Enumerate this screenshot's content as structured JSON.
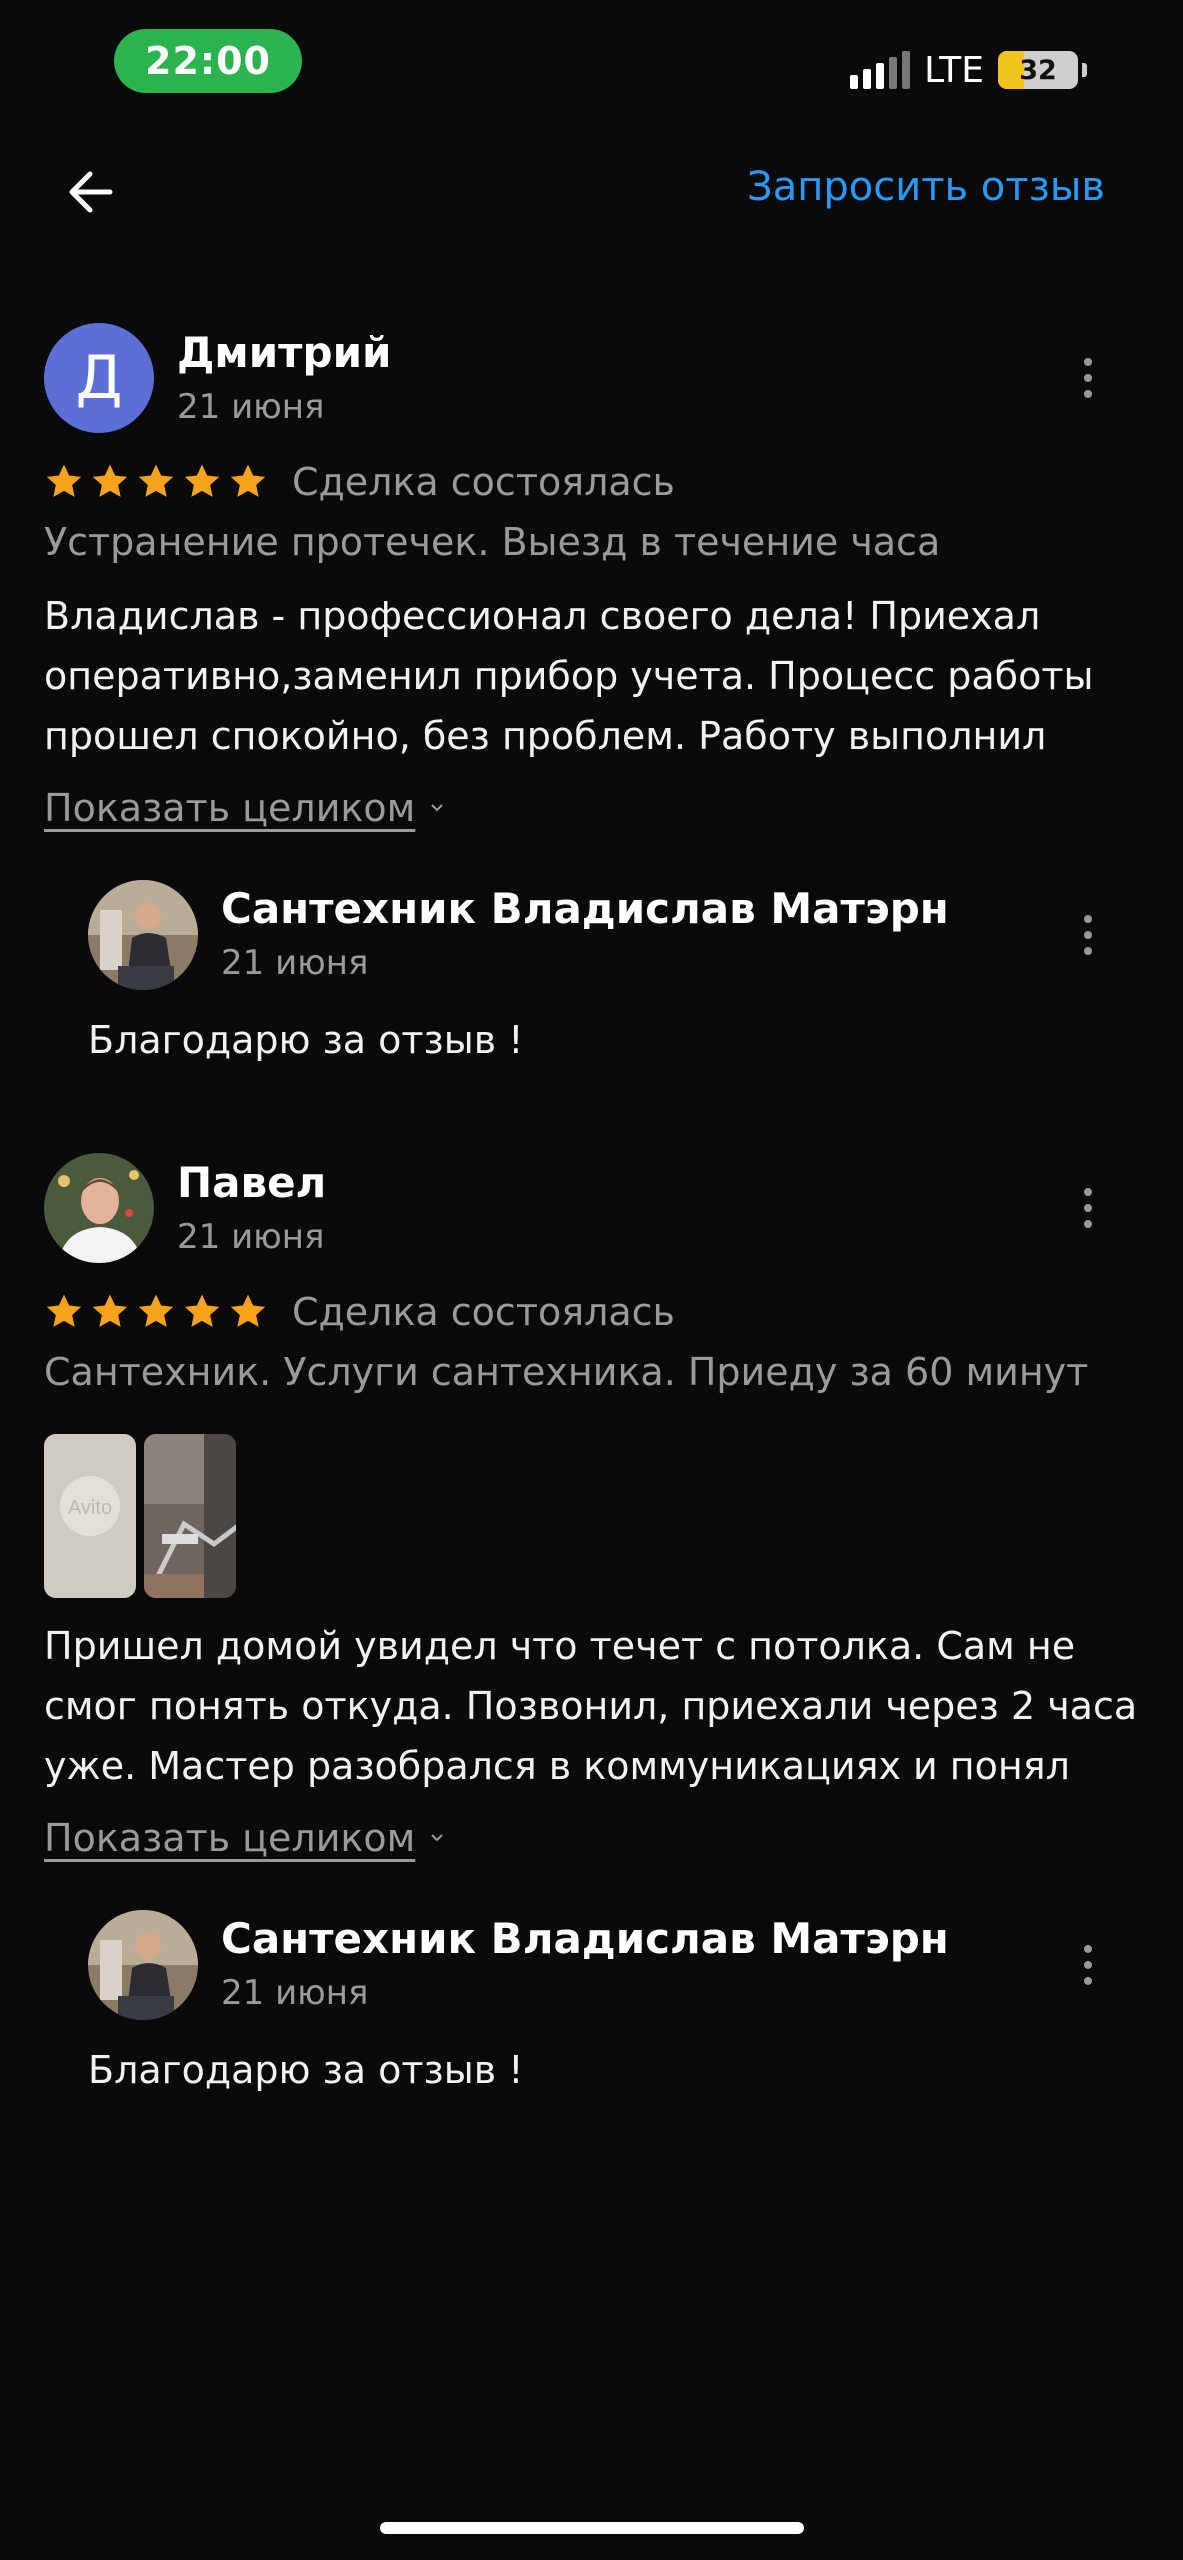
{
  "status_bar": {
    "time": "22:00",
    "network": "LTE",
    "battery": "32"
  },
  "header": {
    "back_icon": "arrow-left-icon",
    "request_review": "Запросить отзыв"
  },
  "reviews": [
    {
      "avatar_letter": "Д",
      "name": "Дмитрий",
      "date": "21 июня",
      "rating": 5,
      "deal_status": "Сделка состоялась",
      "service": "Устранение протечек. Выезд в течение часа",
      "text": "Владислав - профессионал своего дела! Приехал оперативно,заменил прибор учета. Процесс работы прошел спокойно, без проблем. Работу выполнил",
      "show_more": "Показать целиком",
      "reply": {
        "name": "Сантехник Владислав Матэрн",
        "date": "21 июня",
        "text": "Благодарю за отзыв !"
      }
    },
    {
      "name": "Павел",
      "date": "21 июня",
      "rating": 5,
      "deal_status": "Сделка состоялась",
      "service": "Сантехник. Услуги сантехника. Приеду за 60 минут",
      "photo_watermark": "Avito",
      "text": "Пришел домой увидел что течет с потолка. Сам не смог понять откуда. Позвонил, приехали через 2 часа уже. Мастер разобрался в коммуникациях и понял",
      "show_more": "Показать целиком",
      "reply": {
        "name": "Сантехник Владислав Матэрн",
        "date": "21 июня",
        "text": "Благодарю за отзыв !"
      }
    }
  ],
  "colors": {
    "accent": "#2a9af7",
    "star": "#f7a21b",
    "background": "#0a0a0a",
    "muted": "#9a9a9a"
  }
}
